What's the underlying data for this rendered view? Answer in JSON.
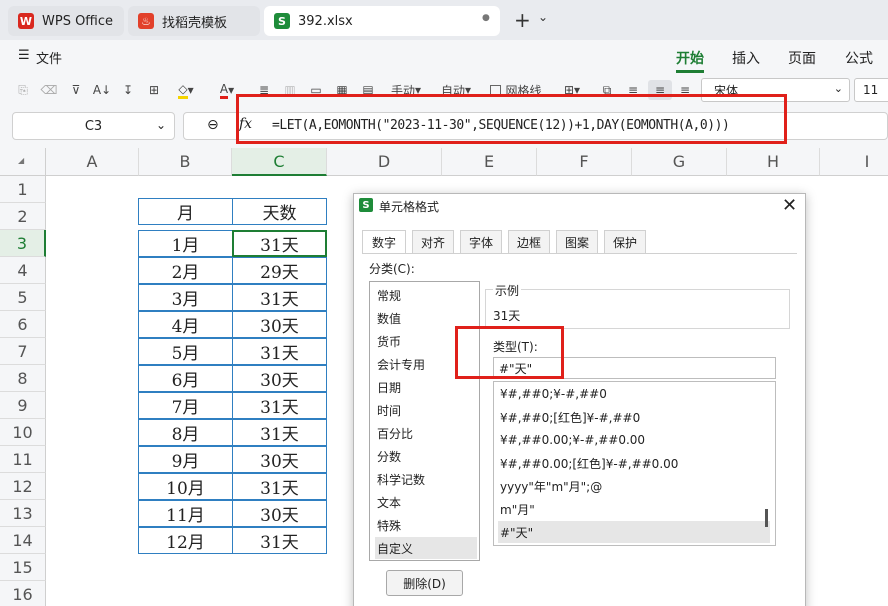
{
  "tabs": [
    {
      "label": "WPS Office",
      "icon": "wps-logo-icon"
    },
    {
      "label": "找稻壳模板",
      "icon": "docer-icon"
    },
    {
      "label": "392.xlsx",
      "icon": "spreadsheet-icon",
      "close": "●"
    }
  ],
  "tabbar": {
    "add": "+",
    "chevron": "⌄"
  },
  "menu": {
    "file": "文件",
    "ribbon_tabs": [
      "开始",
      "插入",
      "页面",
      "公式"
    ]
  },
  "toolbar": {
    "manual": "手动",
    "auto": "自动",
    "gridlines": "网格线",
    "font_name": "宋体",
    "font_size": "11"
  },
  "formula_bar": {
    "cell_ref": "C3",
    "fx": "fx",
    "formula": "=LET(A,EOMONTH(\"2023-11-30\",SEQUENCE(12))+1,DAY(EOMONTH(A,0)))"
  },
  "columns": [
    "A",
    "B",
    "C",
    "D",
    "E",
    "F",
    "G",
    "H",
    "I"
  ],
  "rows": [
    "1",
    "2",
    "3",
    "4",
    "5",
    "6",
    "7",
    "8",
    "9",
    "10",
    "11",
    "12",
    "13",
    "14",
    "15",
    "16"
  ],
  "table": {
    "headers": [
      "月",
      "天数"
    ],
    "months": [
      "1月",
      "2月",
      "3月",
      "4月",
      "5月",
      "6月",
      "7月",
      "8月",
      "9月",
      "10月",
      "11月",
      "12月"
    ],
    "days": [
      "31天",
      "29天",
      "31天",
      "30天",
      "31天",
      "30天",
      "31天",
      "31天",
      "30天",
      "31天",
      "30天",
      "31天"
    ]
  },
  "dialog": {
    "title": "单元格格式",
    "title_icon": "S",
    "tabs": [
      "数字",
      "对齐",
      "字体",
      "边框",
      "图案",
      "保护"
    ],
    "category_label": "分类(C):",
    "categories": [
      "常规",
      "数值",
      "货币",
      "会计专用",
      "日期",
      "时间",
      "百分比",
      "分数",
      "科学记数",
      "文本",
      "特殊",
      "自定义"
    ],
    "sample_label": "示例",
    "sample_value": "31天",
    "type_label": "类型(T):",
    "type_value": "#\"天\"",
    "formats": [
      "¥#,##0;¥-#,##0",
      "¥#,##0;[红色]¥-#,##0",
      "¥#,##0.00;¥-#,##0.00",
      "¥#,##0.00;[红色]¥-#,##0.00",
      "yyyy\"年\"m\"月\";@",
      "m\"月\"",
      "#\"天\""
    ],
    "delete_button": "删除(D)"
  },
  "colors": {
    "accent_green": "#1e7e34",
    "highlight_red": "#e0201a",
    "table_border": "#2f7fc1",
    "tab_bg": "#e9ebef"
  }
}
